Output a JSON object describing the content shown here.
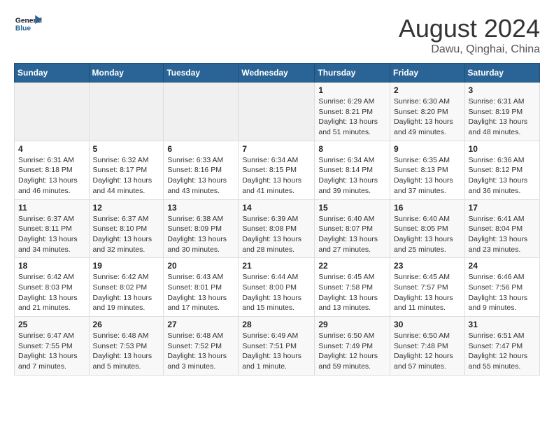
{
  "header": {
    "logo_general": "General",
    "logo_blue": "Blue",
    "month_year": "August 2024",
    "location": "Dawu, Qinghai, China"
  },
  "weekdays": [
    "Sunday",
    "Monday",
    "Tuesday",
    "Wednesday",
    "Thursday",
    "Friday",
    "Saturday"
  ],
  "weeks": [
    [
      {
        "day": "",
        "info": ""
      },
      {
        "day": "",
        "info": ""
      },
      {
        "day": "",
        "info": ""
      },
      {
        "day": "",
        "info": ""
      },
      {
        "day": "1",
        "info": "Sunrise: 6:29 AM\nSunset: 8:21 PM\nDaylight: 13 hours and 51 minutes."
      },
      {
        "day": "2",
        "info": "Sunrise: 6:30 AM\nSunset: 8:20 PM\nDaylight: 13 hours and 49 minutes."
      },
      {
        "day": "3",
        "info": "Sunrise: 6:31 AM\nSunset: 8:19 PM\nDaylight: 13 hours and 48 minutes."
      }
    ],
    [
      {
        "day": "4",
        "info": "Sunrise: 6:31 AM\nSunset: 8:18 PM\nDaylight: 13 hours and 46 minutes."
      },
      {
        "day": "5",
        "info": "Sunrise: 6:32 AM\nSunset: 8:17 PM\nDaylight: 13 hours and 44 minutes."
      },
      {
        "day": "6",
        "info": "Sunrise: 6:33 AM\nSunset: 8:16 PM\nDaylight: 13 hours and 43 minutes."
      },
      {
        "day": "7",
        "info": "Sunrise: 6:34 AM\nSunset: 8:15 PM\nDaylight: 13 hours and 41 minutes."
      },
      {
        "day": "8",
        "info": "Sunrise: 6:34 AM\nSunset: 8:14 PM\nDaylight: 13 hours and 39 minutes."
      },
      {
        "day": "9",
        "info": "Sunrise: 6:35 AM\nSunset: 8:13 PM\nDaylight: 13 hours and 37 minutes."
      },
      {
        "day": "10",
        "info": "Sunrise: 6:36 AM\nSunset: 8:12 PM\nDaylight: 13 hours and 36 minutes."
      }
    ],
    [
      {
        "day": "11",
        "info": "Sunrise: 6:37 AM\nSunset: 8:11 PM\nDaylight: 13 hours and 34 minutes."
      },
      {
        "day": "12",
        "info": "Sunrise: 6:37 AM\nSunset: 8:10 PM\nDaylight: 13 hours and 32 minutes."
      },
      {
        "day": "13",
        "info": "Sunrise: 6:38 AM\nSunset: 8:09 PM\nDaylight: 13 hours and 30 minutes."
      },
      {
        "day": "14",
        "info": "Sunrise: 6:39 AM\nSunset: 8:08 PM\nDaylight: 13 hours and 28 minutes."
      },
      {
        "day": "15",
        "info": "Sunrise: 6:40 AM\nSunset: 8:07 PM\nDaylight: 13 hours and 27 minutes."
      },
      {
        "day": "16",
        "info": "Sunrise: 6:40 AM\nSunset: 8:05 PM\nDaylight: 13 hours and 25 minutes."
      },
      {
        "day": "17",
        "info": "Sunrise: 6:41 AM\nSunset: 8:04 PM\nDaylight: 13 hours and 23 minutes."
      }
    ],
    [
      {
        "day": "18",
        "info": "Sunrise: 6:42 AM\nSunset: 8:03 PM\nDaylight: 13 hours and 21 minutes."
      },
      {
        "day": "19",
        "info": "Sunrise: 6:42 AM\nSunset: 8:02 PM\nDaylight: 13 hours and 19 minutes."
      },
      {
        "day": "20",
        "info": "Sunrise: 6:43 AM\nSunset: 8:01 PM\nDaylight: 13 hours and 17 minutes."
      },
      {
        "day": "21",
        "info": "Sunrise: 6:44 AM\nSunset: 8:00 PM\nDaylight: 13 hours and 15 minutes."
      },
      {
        "day": "22",
        "info": "Sunrise: 6:45 AM\nSunset: 7:58 PM\nDaylight: 13 hours and 13 minutes."
      },
      {
        "day": "23",
        "info": "Sunrise: 6:45 AM\nSunset: 7:57 PM\nDaylight: 13 hours and 11 minutes."
      },
      {
        "day": "24",
        "info": "Sunrise: 6:46 AM\nSunset: 7:56 PM\nDaylight: 13 hours and 9 minutes."
      }
    ],
    [
      {
        "day": "25",
        "info": "Sunrise: 6:47 AM\nSunset: 7:55 PM\nDaylight: 13 hours and 7 minutes."
      },
      {
        "day": "26",
        "info": "Sunrise: 6:48 AM\nSunset: 7:53 PM\nDaylight: 13 hours and 5 minutes."
      },
      {
        "day": "27",
        "info": "Sunrise: 6:48 AM\nSunset: 7:52 PM\nDaylight: 13 hours and 3 minutes."
      },
      {
        "day": "28",
        "info": "Sunrise: 6:49 AM\nSunset: 7:51 PM\nDaylight: 13 hours and 1 minute."
      },
      {
        "day": "29",
        "info": "Sunrise: 6:50 AM\nSunset: 7:49 PM\nDaylight: 12 hours and 59 minutes."
      },
      {
        "day": "30",
        "info": "Sunrise: 6:50 AM\nSunset: 7:48 PM\nDaylight: 12 hours and 57 minutes."
      },
      {
        "day": "31",
        "info": "Sunrise: 6:51 AM\nSunset: 7:47 PM\nDaylight: 12 hours and 55 minutes."
      }
    ]
  ]
}
